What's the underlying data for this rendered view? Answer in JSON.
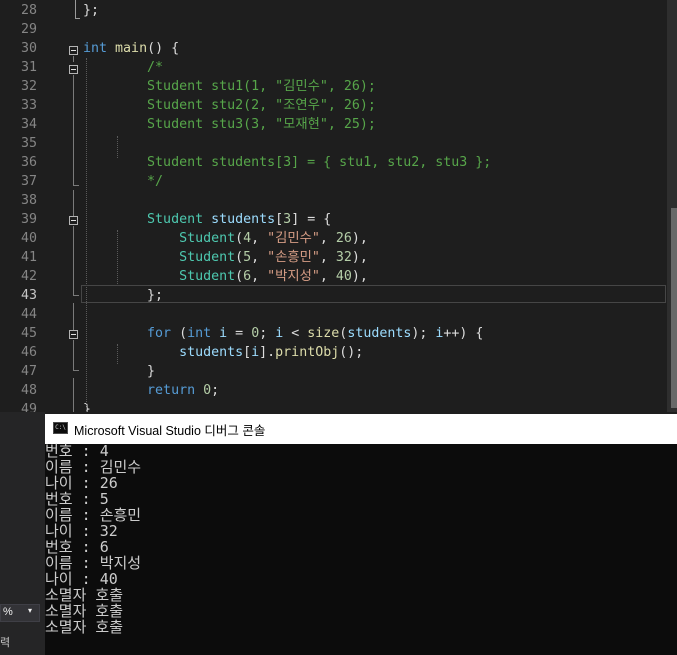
{
  "editor": {
    "current_line": "43",
    "lines": [
      {
        "n": "28",
        "pre": "",
        "code": [
          [
            "pl",
            "};"
          ]
        ]
      },
      {
        "n": "29",
        "pre": "",
        "code": []
      },
      {
        "n": "30",
        "pre": "",
        "code": [
          [
            "kw",
            "int"
          ],
          [
            "pl",
            " "
          ],
          [
            "fn",
            "main"
          ],
          [
            "pl",
            "() {"
          ]
        ]
      },
      {
        "n": "31",
        "pre": "        ",
        "code": [
          [
            "cm",
            "/*"
          ]
        ]
      },
      {
        "n": "32",
        "pre": "        ",
        "code": [
          [
            "cm",
            "Student stu1(1, \"김민수\", 26);"
          ]
        ]
      },
      {
        "n": "33",
        "pre": "        ",
        "code": [
          [
            "cm",
            "Student stu2(2, \"조연우\", 26);"
          ]
        ]
      },
      {
        "n": "34",
        "pre": "        ",
        "code": [
          [
            "cm",
            "Student stu3(3, \"모재현\", 25);"
          ]
        ]
      },
      {
        "n": "35",
        "pre": "",
        "code": []
      },
      {
        "n": "36",
        "pre": "        ",
        "code": [
          [
            "cm",
            "Student students[3] = { stu1, stu2, stu3 };"
          ]
        ]
      },
      {
        "n": "37",
        "pre": "        ",
        "code": [
          [
            "cm",
            "*/"
          ]
        ]
      },
      {
        "n": "38",
        "pre": "",
        "code": []
      },
      {
        "n": "39",
        "pre": "        ",
        "code": [
          [
            "ty",
            "Student"
          ],
          [
            "pl",
            " "
          ],
          [
            "var",
            "students"
          ],
          [
            "pl",
            "["
          ],
          [
            "num",
            "3"
          ],
          [
            "pl",
            "] = {"
          ]
        ]
      },
      {
        "n": "40",
        "pre": "            ",
        "code": [
          [
            "ty",
            "Student"
          ],
          [
            "pl",
            "("
          ],
          [
            "num",
            "4"
          ],
          [
            "pl",
            ", "
          ],
          [
            "str",
            "\"김민수\""
          ],
          [
            "pl",
            ", "
          ],
          [
            "num",
            "26"
          ],
          [
            "pl",
            "),"
          ]
        ]
      },
      {
        "n": "41",
        "pre": "            ",
        "code": [
          [
            "ty",
            "Student"
          ],
          [
            "pl",
            "("
          ],
          [
            "num",
            "5"
          ],
          [
            "pl",
            ", "
          ],
          [
            "str",
            "\"손흥민\""
          ],
          [
            "pl",
            ", "
          ],
          [
            "num",
            "32"
          ],
          [
            "pl",
            "),"
          ]
        ]
      },
      {
        "n": "42",
        "pre": "            ",
        "code": [
          [
            "ty",
            "Student"
          ],
          [
            "pl",
            "("
          ],
          [
            "num",
            "6"
          ],
          [
            "pl",
            ", "
          ],
          [
            "str",
            "\"박지성\""
          ],
          [
            "pl",
            ", "
          ],
          [
            "num",
            "40"
          ],
          [
            "pl",
            "),"
          ]
        ]
      },
      {
        "n": "43",
        "pre": "        ",
        "code": [
          [
            "pl",
            "};"
          ]
        ]
      },
      {
        "n": "44",
        "pre": "",
        "code": []
      },
      {
        "n": "45",
        "pre": "        ",
        "code": [
          [
            "kw",
            "for"
          ],
          [
            "pl",
            " ("
          ],
          [
            "kw",
            "int"
          ],
          [
            "pl",
            " "
          ],
          [
            "var",
            "i"
          ],
          [
            "pl",
            " = "
          ],
          [
            "num",
            "0"
          ],
          [
            "pl",
            "; "
          ],
          [
            "var",
            "i"
          ],
          [
            "pl",
            " < "
          ],
          [
            "fn",
            "size"
          ],
          [
            "pl",
            "("
          ],
          [
            "var",
            "students"
          ],
          [
            "pl",
            "); "
          ],
          [
            "var",
            "i"
          ],
          [
            "pl",
            "++) {"
          ]
        ]
      },
      {
        "n": "46",
        "pre": "            ",
        "code": [
          [
            "var",
            "students"
          ],
          [
            "pl",
            "["
          ],
          [
            "var",
            "i"
          ],
          [
            "pl",
            "]."
          ],
          [
            "fn",
            "printObj"
          ],
          [
            "pl",
            "();"
          ]
        ]
      },
      {
        "n": "47",
        "pre": "        ",
        "code": [
          [
            "pl",
            "}"
          ]
        ]
      },
      {
        "n": "48",
        "pre": "        ",
        "code": [
          [
            "kw",
            "return"
          ],
          [
            "pl",
            " "
          ],
          [
            "num",
            "0"
          ],
          [
            "pl",
            ";"
          ]
        ]
      },
      {
        "n": "49",
        "pre": "",
        "code": [
          [
            "pl",
            "}"
          ]
        ]
      }
    ]
  },
  "console": {
    "title": "Microsoft Visual Studio 디버그 콘솔",
    "icon_text": "C:\\",
    "output": [
      "번호 : 4",
      "이름 : 김민수",
      "나이 : 26",
      "번호 : 5",
      "이름 : 손흥민",
      "나이 : 32",
      "번호 : 6",
      "이름 : 박지성",
      "나이 : 40",
      "소멸자 호출",
      "소멸자 호출",
      "소멸자 호출"
    ]
  },
  "statusbar": {
    "zoom_label": "%",
    "zoom_arrow": "▾",
    "bottom_text": "력"
  },
  "colors": {
    "keyword": "#569cd6",
    "function": "#dcdcaa",
    "comment": "#57a64a",
    "type": "#4ec9b0",
    "string": "#d69d85",
    "number": "#b5cea8"
  }
}
